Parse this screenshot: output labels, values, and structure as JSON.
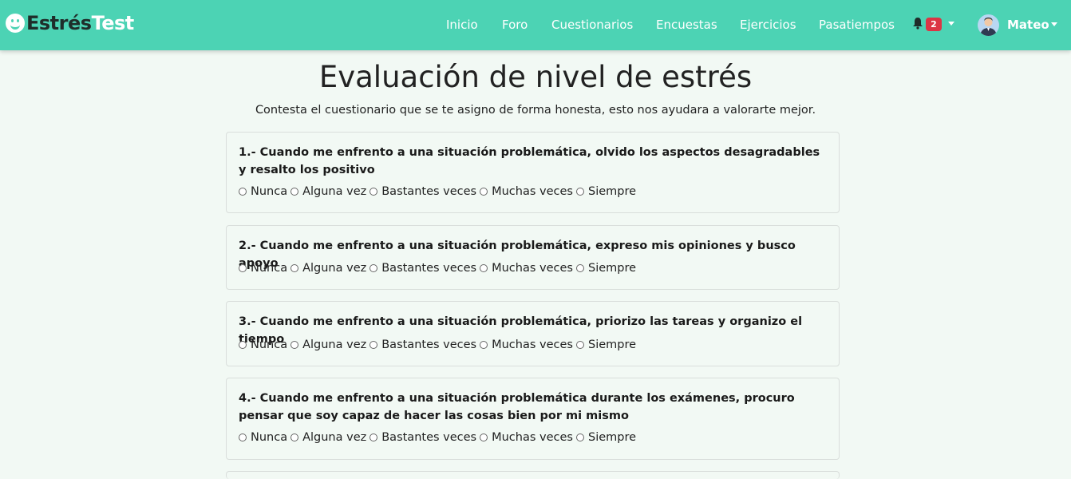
{
  "brand": {
    "part1": "Estrés",
    "part2": "Test"
  },
  "nav": {
    "items": [
      "Inicio",
      "Foro",
      "Cuestionarios",
      "Encuestas",
      "Ejercicios",
      "Pasatiempos"
    ],
    "notification_count": "2",
    "user_name": "Mateo"
  },
  "page": {
    "title": "Evaluación de nivel de estrés",
    "subtitle": "Contesta el cuestionario que se te asigno de forma honesta, esto nos ayudara a valorarte mejor."
  },
  "options": [
    "Nunca",
    "Alguna vez",
    "Bastantes veces",
    "Muchas veces",
    "Siempre"
  ],
  "questions": [
    {
      "text": "1.- Cuando me enfrento a una situación problemática, olvido los aspectos desagradables y resalto los positivo"
    },
    {
      "text": "2.- Cuando me enfrento a una situación problemática, expreso mis opiniones y busco apoyo"
    },
    {
      "text": "3.- Cuando me enfrento a una situación problemática, priorizo las tareas y organizo el tiempo"
    },
    {
      "text": "4.- Cuando me enfrento a una situación problemática durante los exámenes, procuro pensar que soy capaz de hacer las cosas bien por mi mismo"
    }
  ],
  "colors": {
    "navbar": "#4cd3b4",
    "background": "#f2f9f4",
    "badge": "#dc3545"
  }
}
